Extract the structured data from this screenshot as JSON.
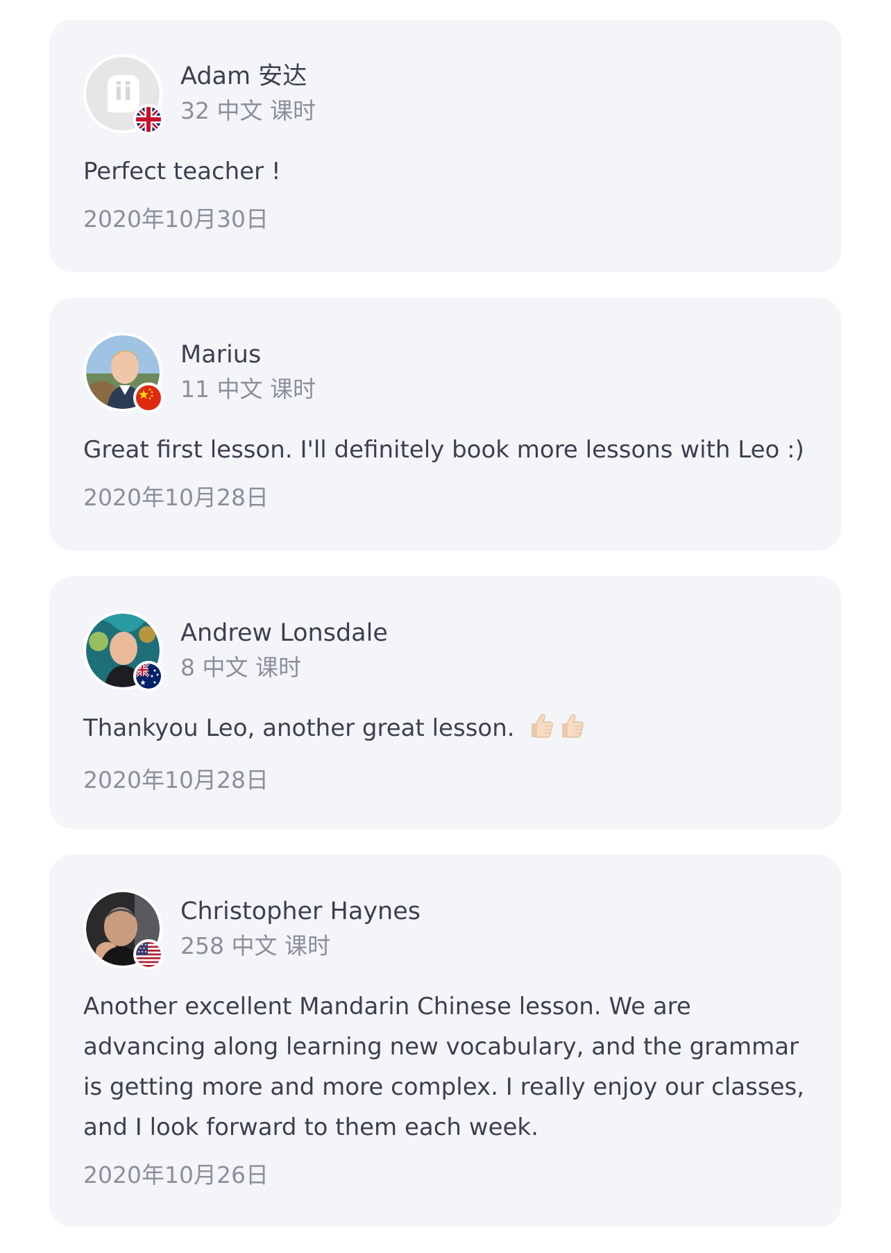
{
  "reviews": [
    {
      "author": "Adam 安达",
      "lesson_count": "32 中文 课时",
      "text": "Perfect teacher !",
      "date": "2020年10月30日",
      "avatar": "default-logo-avatar",
      "avatar_logo_text": "ii",
      "flag": "uk-flag-icon"
    },
    {
      "author": "Marius",
      "lesson_count": "11 中文 课时",
      "text": "Great first lesson. I'll definitely book more lessons with Leo :)",
      "date": "2020年10月28日",
      "avatar": "user-photo-avatar",
      "flag": "china-flag-icon"
    },
    {
      "author": "Andrew Lonsdale",
      "lesson_count": "8 中文 课时",
      "text": "Thankyou Leo, another great lesson.",
      "emoji": "thumbs-up-icon x2",
      "date": "2020年10月28日",
      "avatar": "user-photo-avatar",
      "flag": "australia-flag-icon"
    },
    {
      "author": "Christopher Haynes",
      "lesson_count": "258 中文 课时",
      "text": "Another excellent Mandarin Chinese lesson. We are advancing along learning new vocabulary, and the grammar is getting more and more complex. I really enjoy our classes, and I look forward to them each week.",
      "date": "2020年10月26日",
      "avatar": "user-photo-avatar",
      "flag": "usa-flag-icon"
    }
  ],
  "colors": {
    "card_background": "#f4f5f9",
    "primary_text": "#3d3f4f",
    "secondary_text": "#8c8e9c"
  }
}
